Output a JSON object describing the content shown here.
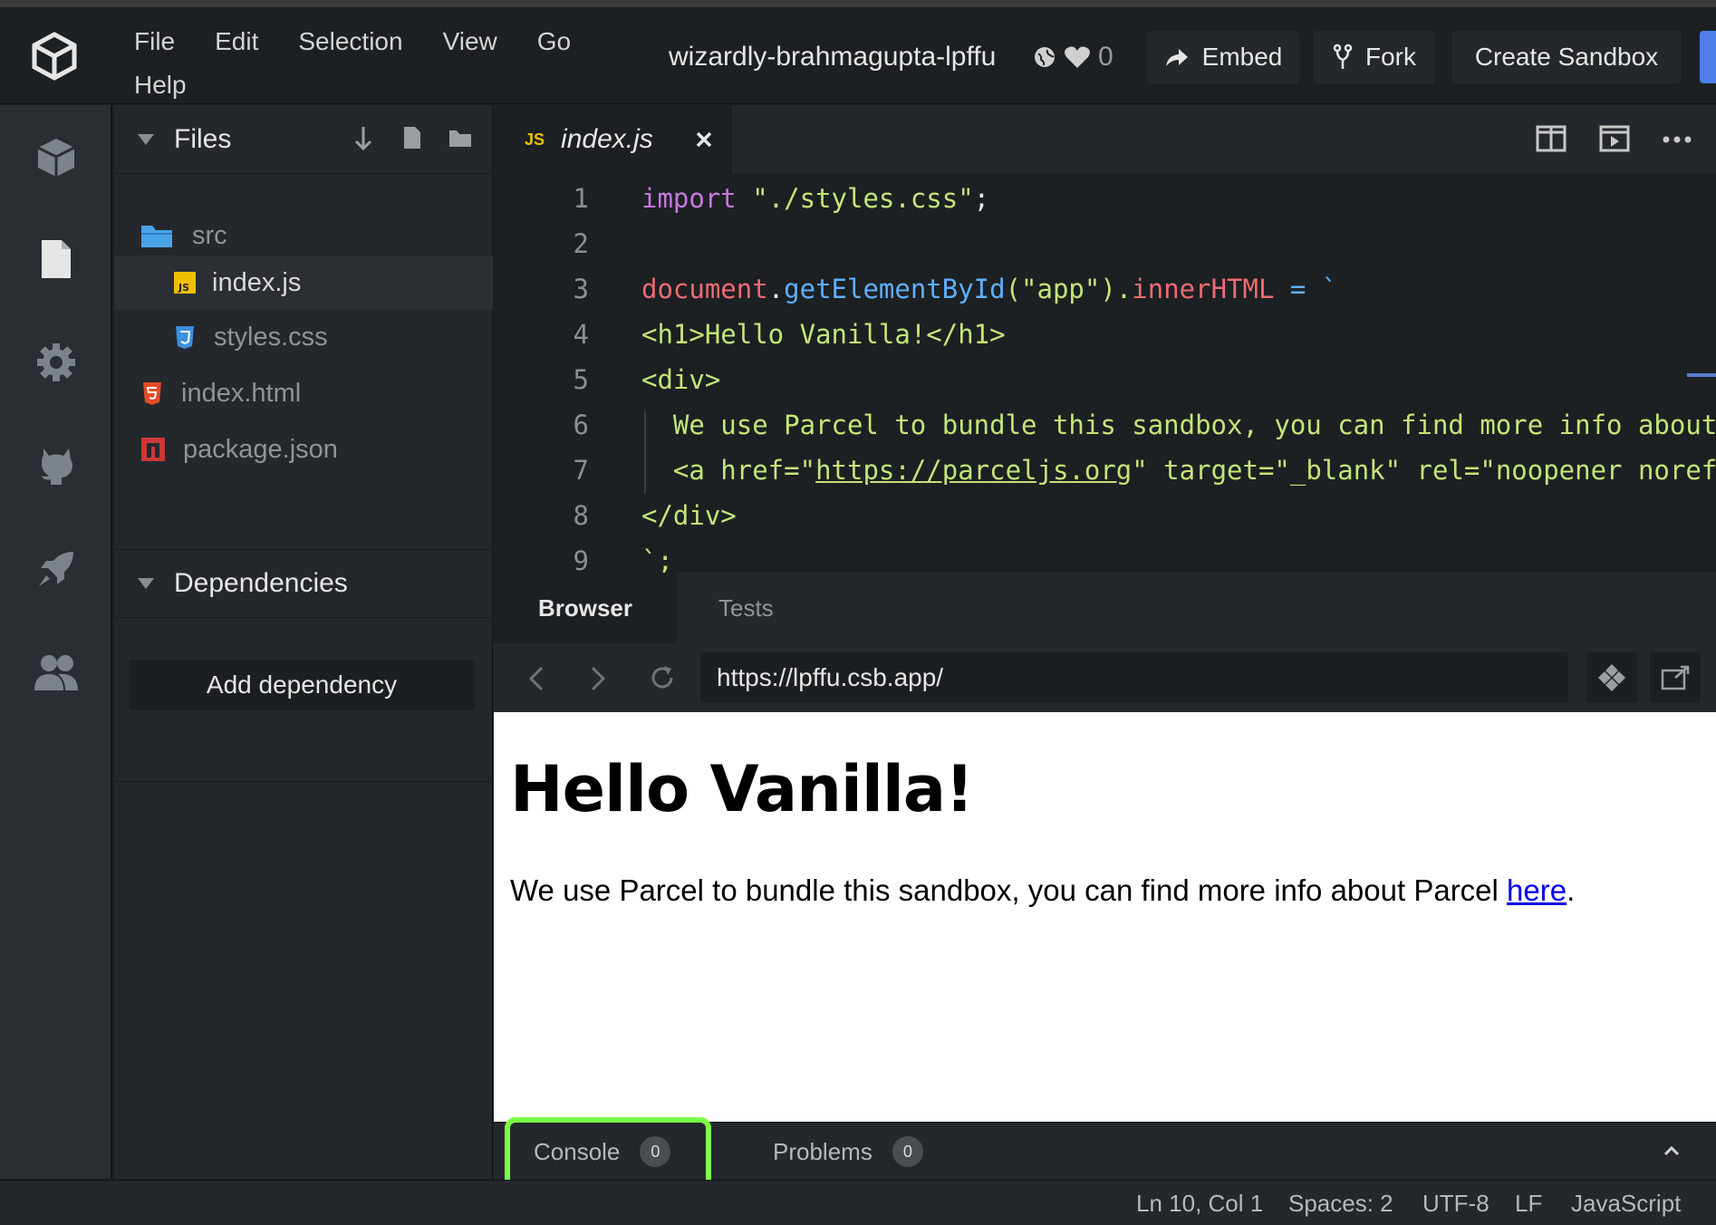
{
  "menu": [
    "File",
    "Edit",
    "Selection",
    "View",
    "Go",
    "Help"
  ],
  "sandbox_title": "wizardly-brahmagupta-lpffu",
  "likes": "0",
  "header_buttons": {
    "embed": "Embed",
    "fork": "Fork",
    "create": "Create Sandbox"
  },
  "sidebar": {
    "files_label": "Files",
    "files": [
      {
        "name": "src",
        "icon": "folder-icon"
      },
      {
        "name": "index.js",
        "icon": "js-file-icon"
      },
      {
        "name": "styles.css",
        "icon": "css-file-icon"
      },
      {
        "name": "index.html",
        "icon": "html-file-icon"
      },
      {
        "name": "package.json",
        "icon": "npm-file-icon"
      }
    ],
    "dependencies_label": "Dependencies",
    "add_dependency": "Add dependency"
  },
  "editor": {
    "tab_name": "index.js",
    "tab_icon_text": "JS",
    "line_numbers": [
      "1",
      "2",
      "3",
      "4",
      "5",
      "6",
      "7",
      "8",
      "9"
    ],
    "code": {
      "l1_kw": "import",
      "l1_str": "\"./styles.css\"",
      "l1_end": ";",
      "l3_obj": "document",
      "l3_dot": ".",
      "l3_fn": "getElementById",
      "l3_arg": "(\"app\").",
      "l3_prop": "innerHTML",
      "l3_rest": " = `",
      "l4": "<h1>Hello Vanilla!</h1>",
      "l5": "<div>",
      "l6": "  We use Parcel to bundle this sandbox, you can find more info about Parcel",
      "l7_a": "  <a href=\"",
      "l7_url": "https://parceljs.org",
      "l7_b": "\" target=\"_blank\" rel=\"noopener noreferrer\">here</a>.",
      "l8": "</div>",
      "l9": "`;"
    }
  },
  "preview_tabs": {
    "browser": "Browser",
    "tests": "Tests"
  },
  "url": "https://lpffu.csb.app/",
  "preview": {
    "heading": "Hello Vanilla!",
    "text": "We use Parcel to bundle this sandbox, you can find more info about Parcel ",
    "link": "here",
    "period": "."
  },
  "console": {
    "console_label": "Console",
    "console_count": "0",
    "problems_label": "Problems",
    "problems_count": "0"
  },
  "status": {
    "position": "Ln 10, Col 1",
    "spaces": "Spaces: 2",
    "encoding": "UTF-8",
    "eol": "LF",
    "language": "JavaScript"
  },
  "colors": {
    "highlight": "#7cff4a",
    "js": "#f0c000",
    "css": "#3d8fe0",
    "html": "#e34c26",
    "npm": "#cb3837"
  }
}
